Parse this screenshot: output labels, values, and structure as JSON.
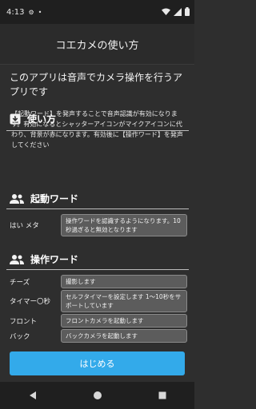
{
  "status_bar": {
    "time": "4:13"
  },
  "appbar": {
    "title": "コエカメの使い方"
  },
  "intro": {
    "text": "このアプリは音声でカメラ操作を行うアプリです"
  },
  "usage": {
    "title": "使い方",
    "description": "【起動ワード】を発声することで音声認識が有効になります。有効になるとシャッターアイコンがマイクアイコンに代わり、背景が赤になります。有効後に【操作ワード】を発声してください"
  },
  "wake_word": {
    "title": "起動ワード",
    "items": [
      {
        "label": "はい メタ",
        "text": "操作ワードを認識するようになります。10秒過ぎると無効となります"
      }
    ]
  },
  "command_word": {
    "title": "操作ワード",
    "items": [
      {
        "label": "チーズ",
        "text": "撮影します"
      },
      {
        "label": "タイマー〇秒",
        "text": "セルフタイマーを設定します 1〜10秒をサポートしています"
      },
      {
        "label": "フロント",
        "text": "フロントカメラを起動します"
      },
      {
        "label": "バック",
        "text": "バックカメラを起動します"
      }
    ]
  },
  "start_button": {
    "label": "はじめる"
  },
  "colors": {
    "accent": "#33aaea",
    "background": "#2e2e2e",
    "box": "#5c5c5c"
  }
}
